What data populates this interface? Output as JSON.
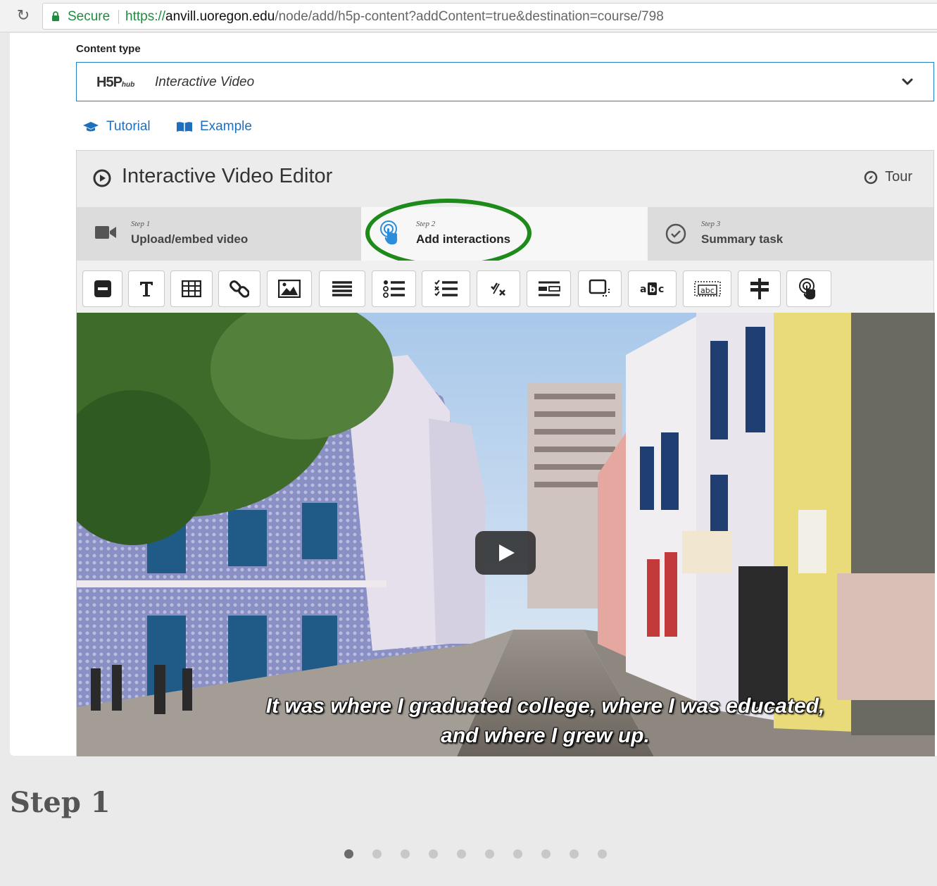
{
  "browser": {
    "secure_label": "Secure",
    "url_scheme": "https://",
    "url_host": "anvill.uoregon.edu",
    "url_path": "/node/add/h5p-content?addContent=true&destination=course/798"
  },
  "content_type": {
    "label": "Content type",
    "logo_main": "H5P",
    "logo_sub": "hub",
    "selected": "Interactive Video"
  },
  "links": {
    "tutorial": "Tutorial",
    "example": "Example"
  },
  "editor": {
    "title": "Interactive Video Editor",
    "tour": "Tour",
    "steps": [
      {
        "num": "Step 1",
        "label": "Upload/embed video"
      },
      {
        "num": "Step 2",
        "label": "Add interactions"
      },
      {
        "num": "Step 3",
        "label": "Summary task"
      }
    ],
    "toolbar": [
      "label-icon",
      "text-icon",
      "table-icon",
      "link-icon",
      "image-icon",
      "statements-icon",
      "single-choice-icon",
      "multiple-choice-icon",
      "true-false-icon",
      "fill-in-blanks-icon",
      "drag-and-drop-icon",
      "mark-words-icon",
      "drag-text-icon",
      "crossroads-icon",
      "navigation-hotspot-icon"
    ],
    "video": {
      "caption_line1": "It was where I graduated college, where I was educated,",
      "caption_line2": "and where I grew up."
    }
  },
  "footer": {
    "heading": "Step 1",
    "dot_count": 10,
    "active_dot": 1
  },
  "colors": {
    "accent_blue": "#1f6fbd",
    "highlight_green": "#1d8a19",
    "secure_green": "#1e8e3e"
  }
}
